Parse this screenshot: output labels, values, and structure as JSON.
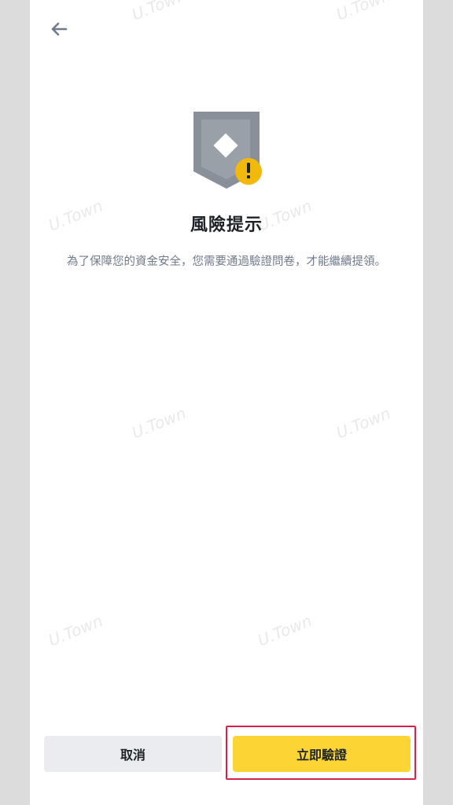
{
  "page": {
    "title": "風險提示",
    "description": "為了保障您的資金安全，您需要通過驗證問卷，才能繼續提領。"
  },
  "buttons": {
    "cancel_label": "取消",
    "verify_label": "立即驗證"
  },
  "watermark": {
    "text": "U.Town"
  },
  "icons": {
    "back": "arrow-left-icon",
    "hero": "shield-warning-icon"
  },
  "colors": {
    "accent": "#fcd535",
    "shield": "#8a909a",
    "highlight": "#d6224b",
    "text_primary": "#1e2329",
    "text_secondary": "#707a8a"
  }
}
